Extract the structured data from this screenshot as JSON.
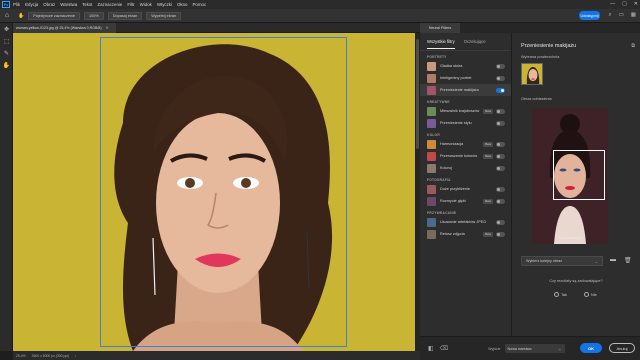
{
  "menubar": {
    "logo": "Ps",
    "items": [
      "Plik",
      "Edycja",
      "Obraz",
      "Warstwa",
      "Tekst",
      "Zaznaczenie",
      "Filtr",
      "Widok",
      "Wtyczki",
      "Okno",
      "Pomoc"
    ],
    "controls": [
      "—",
      "▢",
      "✕"
    ]
  },
  "options": {
    "btn1": "Pojedyncze zaznaczenie",
    "zoom": "100%",
    "btn2": "Dopasuj ekran",
    "btn3": "Wypełnij ekran",
    "share": "Udostępnij"
  },
  "tools": [
    "✥",
    "⬚",
    "✎",
    "✋"
  ],
  "document": {
    "tab_title": "woman-yellow-0123.jpg @ 25,4% (Warstwa 0,RGB/8)",
    "close": "✕",
    "status": [
      "25,4%",
      "3300 x 5000 px (300 ppi)",
      "›"
    ]
  },
  "neural_filters": {
    "tab": "Neural Filters",
    "tabs": [
      "Wszystkie filtry",
      "Oczekujące"
    ],
    "categories": [
      {
        "name": "PORTRETY",
        "filters": [
          {
            "name": "Gładka skóra",
            "badge": "",
            "toggle": "off",
            "color": "#c89a7e"
          },
          {
            "name": "Inteligentny portret",
            "badge": "",
            "toggle": "off",
            "color": "#b27d66"
          },
          {
            "name": "Przeniesienie makijażu",
            "badge": "",
            "toggle": "on",
            "color": "#a3546a"
          }
        ]
      },
      {
        "name": "KREATYWNE",
        "filters": [
          {
            "name": "Mieszalnik krajobrazów",
            "badge": "Beta",
            "toggle": "off",
            "color": "#6c8a5a"
          },
          {
            "name": "Przeniesienie stylu",
            "badge": "",
            "toggle": "off",
            "color": "#7a5a9a"
          }
        ]
      },
      {
        "name": "KOLOR",
        "filters": [
          {
            "name": "Harmonizacja",
            "badge": "Beta",
            "toggle": "off",
            "color": "#d0883a"
          },
          {
            "name": "Przenoszenie kolorów",
            "badge": "Beta",
            "toggle": "off",
            "color": "#c04a4a"
          },
          {
            "name": "Koloruj",
            "badge": "",
            "toggle": "off",
            "color": "#8a7a6a"
          }
        ]
      },
      {
        "name": "FOTOGRAFIA",
        "filters": [
          {
            "name": "Duże przybliżenie",
            "badge": "",
            "toggle": "off",
            "color": "#9a5a5a"
          },
          {
            "name": "Rozmycie głębi",
            "badge": "Beta",
            "toggle": "off",
            "color": "#6a4a6a"
          }
        ]
      },
      {
        "name": "PRZYWRACANIE",
        "filters": [
          {
            "name": "Usuwanie artefaktów JPEG",
            "badge": "",
            "toggle": "off",
            "color": "#4a6a8a"
          },
          {
            "name": "Retusz zdjęcia",
            "badge": "Beta",
            "toggle": "off",
            "color": "#7a6a5a"
          }
        ]
      }
    ]
  },
  "settings": {
    "title": "Przeniesienie makijażu",
    "selected_label": "Wybrana powierzchnia",
    "reference_label": "Obraz odniesienia",
    "reference_caption": "Usuń kadrowanie",
    "dropdown_value": "Wybierz kolejny obraz",
    "question": "Czy rezultaty są zadowalające?",
    "yes": "Tak",
    "no": "Nie"
  },
  "bottom": {
    "output_label": "Wyjście",
    "output_value": "Nowa warstwa",
    "ok": "OK",
    "cancel": "Anuluj"
  },
  "colors": {
    "accent": "#1473e6",
    "canvas_bg": "#c4b02e",
    "selection": "#3c83d6"
  }
}
